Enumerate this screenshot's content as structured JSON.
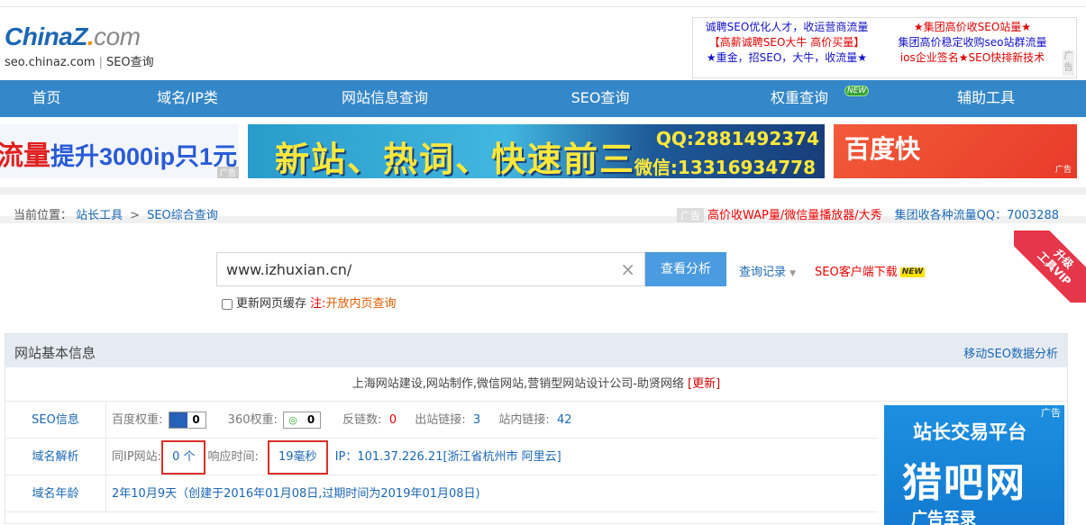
{
  "logo": {
    "main_a": "China",
    "main_z": "Z",
    "main_dot": ".",
    "main_com": "com",
    "sub_domain": "seo.chinaz.com",
    "sub_sep": "|",
    "sub_name": "SEO查询"
  },
  "top_ad": {
    "col1": [
      "诚聘SEO优化人才，收运营商流量",
      "【高薪诚聘SEO大牛 高价买量】",
      "★重金，招SEO，大牛，收流量★"
    ],
    "col2": [
      "★集团高价收SEO站量★",
      "集团高价稳定收购seo站群流量",
      "ios企业签名★SEO快排新技术"
    ],
    "tag": "广告"
  },
  "nav": {
    "items": [
      "首页",
      "域名/IP类",
      "网站信息查询",
      "SEO查询",
      "权重查询",
      "辅助工具"
    ],
    "new_badge": "NEW"
  },
  "banners": {
    "b1_red": "流量",
    "b1_blue": "提升3000ip只1元",
    "b1_tag": "广告",
    "b2_big": "新站、热词、快速前三",
    "b2_qq": "QQ:2881492374",
    "b2_wx": "微信:13316934778",
    "b3_text": "百度快",
    "b3_tag": "广告"
  },
  "breadcrumb": {
    "prefix": "当前位置：",
    "item1": "站长工具",
    "sep": ">",
    "item2": "SEO综合查询"
  },
  "crumb_ad": {
    "tag": "广告",
    "red": "高价收WAP量/微信量播放器/大秀",
    "blue": "集团收各种流量QQ：7003288"
  },
  "search": {
    "value": "www.izhuxian.cn/",
    "clear_icon": "×",
    "button": "查看分析",
    "history": "查询记录",
    "history_caret": "▼",
    "client": "SEO客户端下载",
    "client_badge": "NEW",
    "cache_label": "更新网页缓存",
    "note": "注:",
    "note_link": "开放内页查询"
  },
  "corner": {
    "line1": "升级",
    "line2": "工具VIP"
  },
  "panel": {
    "title": "网站基本信息",
    "right_link": "移动SEO数据分析",
    "site_title": "上海网站建设,网站制作,微信网站,营销型网站设计公司-助贤网络",
    "update": "[更新]",
    "seo": {
      "label": "SEO信息",
      "baidu_k": "百度权重:",
      "baidu_v": "0",
      "s360_k": "360权重:",
      "s360_v": "0",
      "backlinks_k": "反链数:",
      "backlinks_v": "0",
      "out_k": "出站链接:",
      "out_v": "3",
      "in_k": "站内链接:",
      "in_v": "42"
    },
    "dns": {
      "label": "域名解析",
      "sameip_k": "同IP网站:",
      "sameip_v": "0 个",
      "resp_k": "响应时间:",
      "resp_v": "19毫秒",
      "ip": "IP：101.37.226.21[浙江省杭州市 阿里云]"
    },
    "age": {
      "label": "域名年龄",
      "text": "2年10月9天（创建于2016年01月08日,过期时间为2019年01月08日)"
    }
  },
  "side_ad": {
    "t1": "站长交易平台",
    "t2": "猎吧网",
    "t3": "广告至录",
    "tag": "广告"
  },
  "colors": {
    "nav_bg": "#3487c8",
    "link": "#1b67b3",
    "red": "#e00000",
    "highlight_box": "#d9302a"
  }
}
